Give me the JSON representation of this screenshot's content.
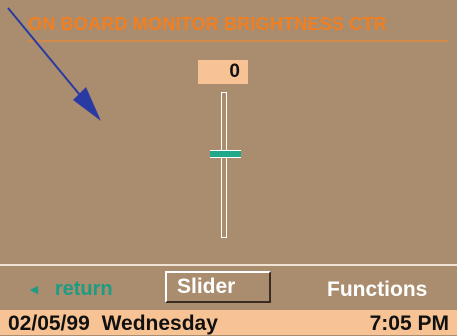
{
  "screen": {
    "title": "ON BOARD MONITOR BRIGHTNESS CTR",
    "title_color": "#f07f22",
    "background_color": "#a98d6e"
  },
  "slider": {
    "value": "0",
    "level_fraction": 0.5,
    "thumb_color": "#1fa88a"
  },
  "menu": {
    "return_icon": "left-triangle-icon",
    "return_arrow": "◄",
    "return_label": "return",
    "selected_label": "Slider",
    "functions_label": "Functions"
  },
  "status": {
    "date": "02/05/99",
    "day": "Wednesday",
    "time": "7:05 PM"
  },
  "annotation": {
    "icon": "pointer-arrow-icon",
    "color": "#2a3aa3"
  }
}
